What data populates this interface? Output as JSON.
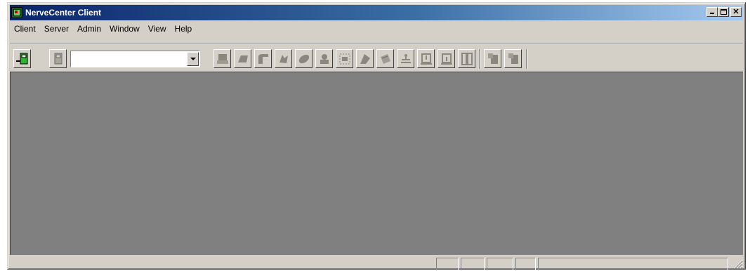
{
  "window": {
    "title": "NerveCenter Client"
  },
  "caption": {
    "minimize": "_",
    "maximize": "□",
    "close": "✕"
  },
  "menus": [
    "Client",
    "Server",
    "Admin",
    "Window",
    "View",
    "Help"
  ],
  "toolbar": {
    "server_combo_value": "",
    "icons": [
      "connect-server-icon",
      "disconnect-server-icon",
      "node-list-icon",
      "alarm-icon",
      "property-group-icon",
      "monitor-icon",
      "poll-icon",
      "mask-icon",
      "behavior-model-icon",
      "severity-icon",
      "action-router-icon",
      "import-icon",
      "export-icon",
      "report-icon",
      "help-topics-icon",
      "about-icon"
    ]
  },
  "colors": {
    "title_start": "#0a246a",
    "title_end": "#a6caf0",
    "client_area": "#808080",
    "face": "#d4d0c8"
  },
  "status": {
    "panes": [
      "",
      "",
      "",
      "",
      ""
    ]
  }
}
